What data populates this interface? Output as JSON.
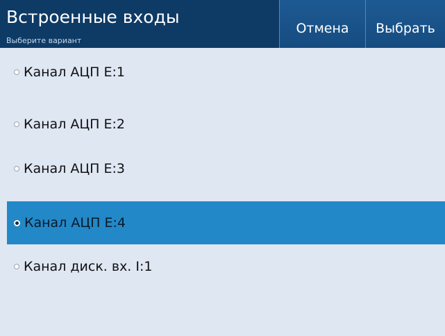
{
  "header": {
    "title": "Встроенные входы",
    "subtitle": "Выберите вариант",
    "cancel_label": "Отмена",
    "select_label": "Выбрать"
  },
  "options": [
    {
      "label": "Канал АЦП E:1",
      "selected": false
    },
    {
      "label": "Канал АЦП E:2",
      "selected": false
    },
    {
      "label": "Канал АЦП E:3",
      "selected": false
    },
    {
      "label": "Канал АЦП E:4",
      "selected": true
    },
    {
      "label": "Канал диск. вх. I:1",
      "selected": false
    }
  ],
  "colors": {
    "header_bg": "#0e3a66",
    "list_bg": "#dfe7f3",
    "selected_bg": "#2288c8"
  }
}
